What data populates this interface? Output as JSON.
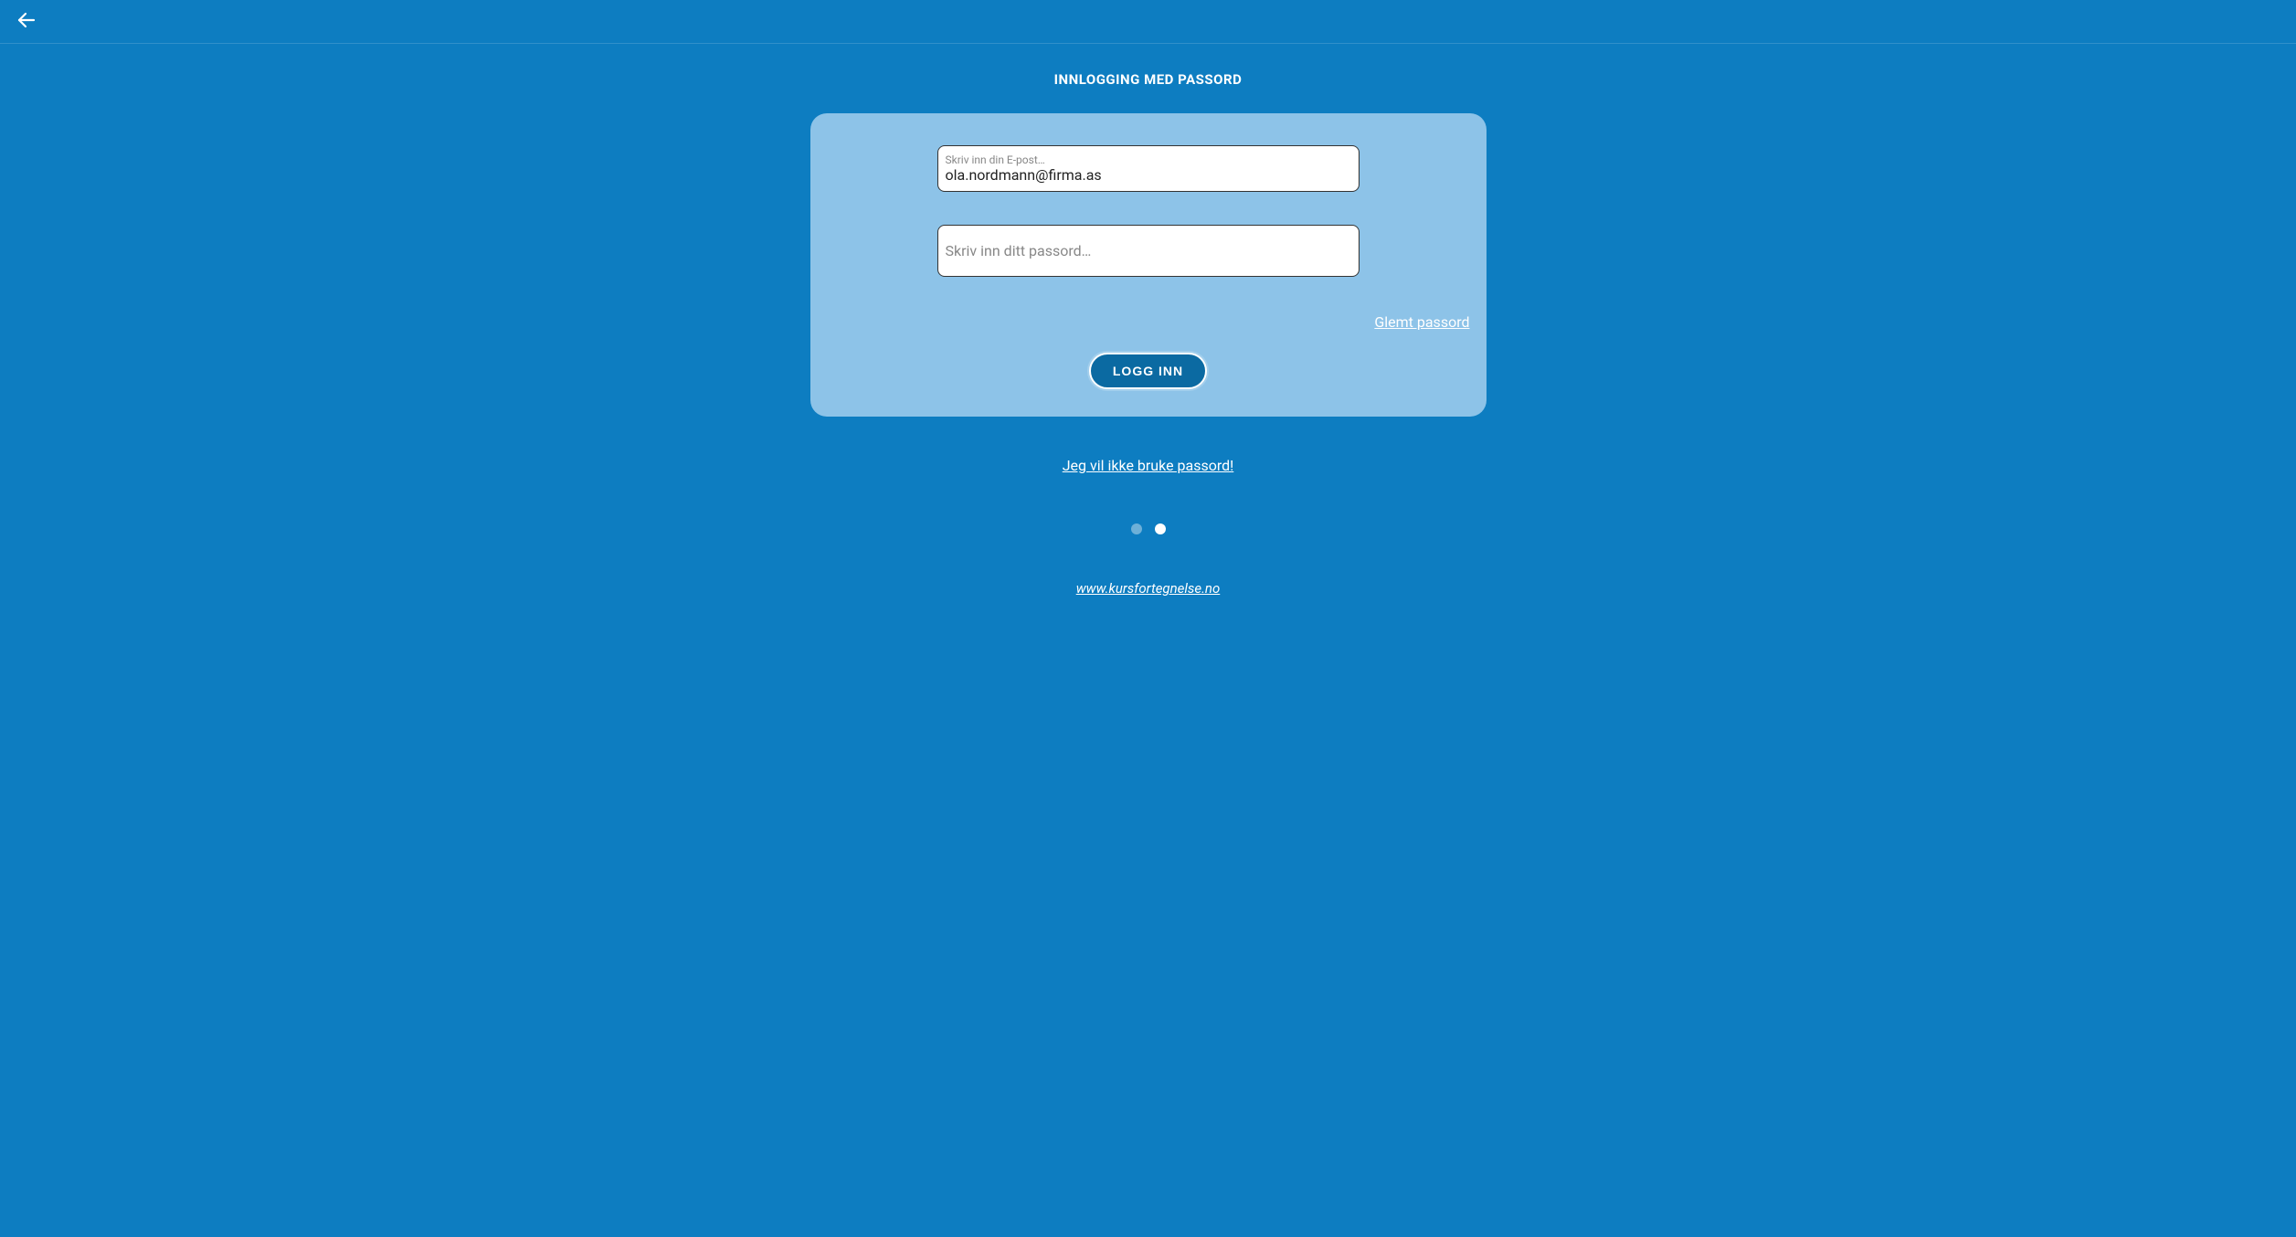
{
  "header": {
    "back_icon": "arrow-left"
  },
  "page": {
    "title": "INNLOGGING MED PASSORD"
  },
  "form": {
    "email_label": "Skriv inn din E-post…",
    "email_value": "ola.nordmann@firma.as",
    "password_placeholder": "Skriv inn ditt passord…",
    "password_value": "",
    "forgot_label": "Glemt passord",
    "login_button": "LOGG INN"
  },
  "links": {
    "no_password": "Jeg vil ikke bruke passord!",
    "footer": "www.kursfortegnelse.no"
  },
  "pagination": {
    "total": 2,
    "active_index": 1
  }
}
